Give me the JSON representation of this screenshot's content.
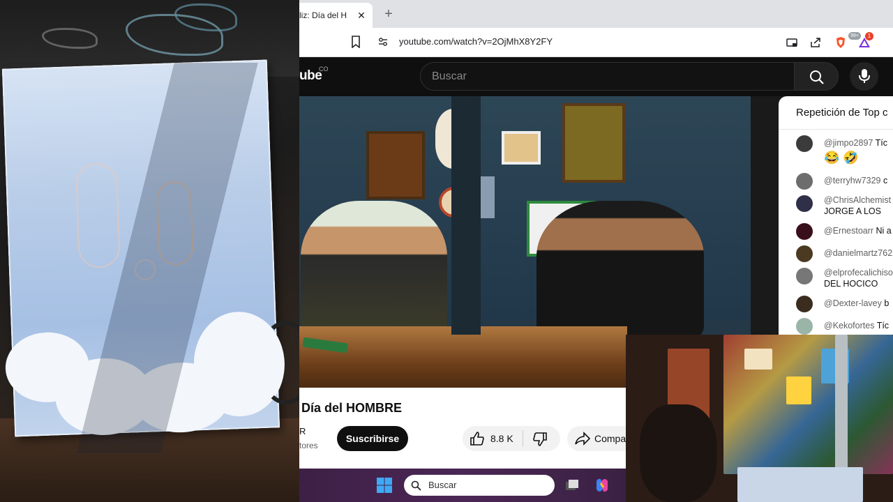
{
  "browser": {
    "tab_title": "liz: Día del H",
    "tab_close": "✕",
    "new_tab": "+",
    "url": "youtube.com/watch?v=2OjMhX8Y2FY",
    "brave_badge": "99+",
    "alert_badge": "1"
  },
  "youtube": {
    "logo_text": "ube",
    "country_code": "CO",
    "search_placeholder": "Buscar",
    "video_title": "Día del HOMBRE",
    "channel_initial": "R",
    "channel_subs": "tores",
    "subscribe_label": "Suscribirse",
    "like_count": "8.8 K",
    "share_label": "Compa"
  },
  "chat": {
    "header": "Repetición de Top c",
    "messages": [
      {
        "author": "@jimpo2897",
        "text": "Tíc",
        "extra": "😂 🤣",
        "avatar_color": "#3b3b3b"
      },
      {
        "author": "@terryhw7329",
        "text": "c",
        "extra": "",
        "avatar_color": "#6d6d6d"
      },
      {
        "author": "@ChrisAlchemist",
        "text": "",
        "extra": "JORGE A LOS",
        "avatar_color": "#2f2f48"
      },
      {
        "author": "@Ernestoarr",
        "text": "Ni a",
        "extra": "",
        "avatar_color": "#3a0f1c"
      },
      {
        "author": "@danielmartz762",
        "text": "",
        "extra": "",
        "avatar_color": "#4b3a22"
      },
      {
        "author": "@elprofecalichiso",
        "text": "",
        "extra": "DEL HOCICO",
        "avatar_color": "#777"
      },
      {
        "author": "@Dexter-lavey",
        "text": "b",
        "extra": "",
        "avatar_color": "#3a2d20"
      },
      {
        "author": "@Kekofortes",
        "text": "Tíc",
        "extra": "",
        "avatar_color": "#9bb4a8"
      }
    ]
  },
  "taskbar": {
    "search_placeholder": "Buscar"
  },
  "colors": {
    "youtube_dark": "#0f0f0f",
    "subscribe_bg": "#0f0f0f",
    "taskbar": "#4b2755",
    "canvas_blue": "#a6c0e4"
  }
}
